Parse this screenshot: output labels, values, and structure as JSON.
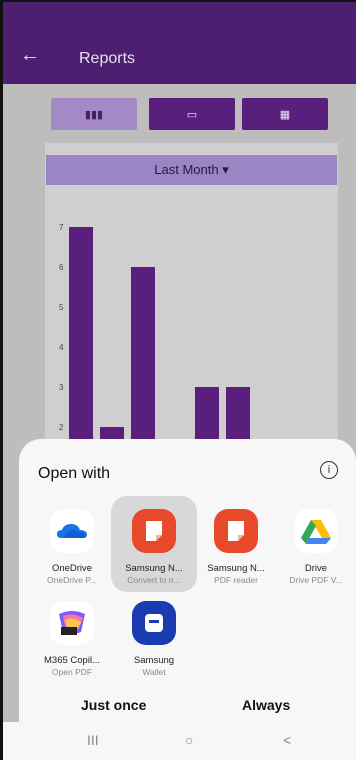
{
  "header": {
    "back_glyph": "←",
    "title": "Reports"
  },
  "tabs": [
    {
      "icon": "bar-chart-icon",
      "active": true
    },
    {
      "icon": "calendar-icon",
      "active": false
    },
    {
      "icon": "calendar-grid-icon",
      "active": false
    }
  ],
  "period": {
    "label": "Last Month ▾"
  },
  "chart_data": {
    "type": "bar",
    "y_ticks": [
      "7",
      "6",
      "5",
      "4",
      "3",
      "2"
    ],
    "values": [
      7,
      2,
      6,
      0,
      3,
      3
    ],
    "ylim": [
      1,
      7
    ]
  },
  "sheet": {
    "title": "Open with",
    "info_glyph": "i",
    "apps": [
      {
        "name": "OneDrive",
        "sub": "OneDrive P...",
        "icon": "onedrive-icon"
      },
      {
        "name": "Samsung N...",
        "sub": "Convert to n...",
        "icon": "samsung-notes-icon"
      },
      {
        "name": "Samsung N...",
        "sub": "PDF reader",
        "icon": "samsung-notes-icon"
      },
      {
        "name": "Drive",
        "sub": "Drive PDF V...",
        "icon": "google-drive-icon"
      },
      {
        "name": "M365 Copil...",
        "sub": "Open PDF",
        "icon": "m365-copilot-icon"
      },
      {
        "name": "Samsung",
        "sub": "Wallet",
        "icon": "samsung-wallet-icon"
      }
    ],
    "just_once": "Just once",
    "always": "Always"
  },
  "navbar": {
    "recents": "III",
    "home": "○",
    "back": "<"
  }
}
